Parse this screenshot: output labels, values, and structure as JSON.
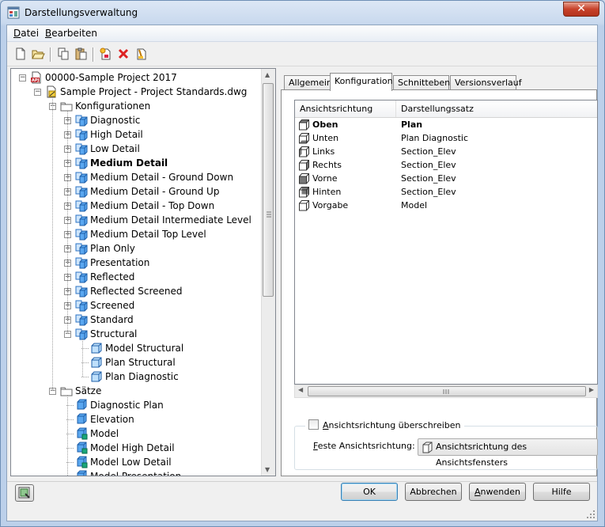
{
  "window": {
    "title": "Darstellungsverwaltung",
    "close_glyph": "✕"
  },
  "menu": [
    {
      "label": "Datei",
      "underline": "D",
      "rest": "atei"
    },
    {
      "label": "Bearbeiten",
      "underline": "B",
      "rest": "earbeiten"
    }
  ],
  "toolbar": [
    "new-icon",
    "open-icon",
    "copy-icon",
    "paste-icon",
    "new-style-icon",
    "delete-icon",
    "purge-icon"
  ],
  "tree": {
    "items": [
      {
        "label": "00000-Sample Project 2017",
        "level": 0,
        "icon": "project-icon",
        "expanded": true
      },
      {
        "label": "Sample Project - Project Standards.dwg",
        "level": 1,
        "icon": "drawing-icon",
        "expanded": true
      },
      {
        "label": "Konfigurationen",
        "level": 2,
        "icon": "folder-icon",
        "expanded": true
      },
      {
        "label": "Diagnostic",
        "level": 3,
        "icon": "config-icon",
        "expandable": true
      },
      {
        "label": "High Detail",
        "level": 3,
        "icon": "config-icon",
        "expandable": true
      },
      {
        "label": "Low Detail",
        "level": 3,
        "icon": "config-icon",
        "expandable": true
      },
      {
        "label": "Medium Detail",
        "level": 3,
        "icon": "config-icon",
        "expandable": true,
        "bold": true
      },
      {
        "label": "Medium Detail - Ground Down",
        "level": 3,
        "icon": "config-icon",
        "expandable": true
      },
      {
        "label": "Medium Detail - Ground Up",
        "level": 3,
        "icon": "config-icon",
        "expandable": true
      },
      {
        "label": "Medium Detail - Top Down",
        "level": 3,
        "icon": "config-icon",
        "expandable": true
      },
      {
        "label": "Medium Detail Intermediate Level",
        "level": 3,
        "icon": "config-icon",
        "expandable": true
      },
      {
        "label": "Medium Detail Top Level",
        "level": 3,
        "icon": "config-icon",
        "expandable": true
      },
      {
        "label": "Plan Only",
        "level": 3,
        "icon": "config-icon",
        "expandable": true
      },
      {
        "label": "Presentation",
        "level": 3,
        "icon": "config-icon",
        "expandable": true
      },
      {
        "label": "Reflected",
        "level": 3,
        "icon": "config-icon",
        "expandable": true
      },
      {
        "label": "Reflected Screened",
        "level": 3,
        "icon": "config-icon",
        "expandable": true
      },
      {
        "label": "Screened",
        "level": 3,
        "icon": "config-icon",
        "expandable": true
      },
      {
        "label": "Standard",
        "level": 3,
        "icon": "config-icon",
        "expandable": true
      },
      {
        "label": "Structural",
        "level": 3,
        "icon": "config-icon",
        "expanded": true
      },
      {
        "label": "Model Structural",
        "level": 4,
        "icon": "cube-icon"
      },
      {
        "label": "Plan Structural",
        "level": 4,
        "icon": "cube-icon"
      },
      {
        "label": "Plan Diagnostic",
        "level": 4,
        "icon": "cube-icon"
      },
      {
        "label": "Sätze",
        "level": 2,
        "icon": "folder-icon",
        "expanded": true
      },
      {
        "label": "Diagnostic Plan",
        "level": 3,
        "icon": "set-icon"
      },
      {
        "label": "Elevation",
        "level": 3,
        "icon": "set-icon"
      },
      {
        "label": "Model",
        "level": 3,
        "icon": "set-model-icon"
      },
      {
        "label": "Model High Detail",
        "level": 3,
        "icon": "set-model-icon"
      },
      {
        "label": "Model Low Detail",
        "level": 3,
        "icon": "set-model-icon"
      },
      {
        "label": "Model Presentation",
        "level": 3,
        "icon": "set-icon"
      }
    ]
  },
  "tabs": [
    {
      "label": "Allgemein",
      "active": false
    },
    {
      "label": "Konfiguration",
      "active": true
    },
    {
      "label": "Schnittebene",
      "active": false
    },
    {
      "label": "Versionsverlauf",
      "active": false
    }
  ],
  "listview": {
    "columns": [
      "Ansichtsrichtung",
      "Darstellungssatz"
    ],
    "rows": [
      {
        "direction": "Oben",
        "set": "Plan",
        "bold": true,
        "face": "top"
      },
      {
        "direction": "Unten",
        "set": "Plan Diagnostic",
        "face": "bottom"
      },
      {
        "direction": "Links",
        "set": "Section_Elev",
        "face": "left"
      },
      {
        "direction": "Rechts",
        "set": "Section_Elev",
        "face": "right"
      },
      {
        "direction": "Vorne",
        "set": "Section_Elev",
        "face": "front"
      },
      {
        "direction": "Hinten",
        "set": "Section_Elev",
        "face": "back"
      },
      {
        "direction": "Vorgabe",
        "set": "Model",
        "face": "none"
      }
    ]
  },
  "override": {
    "checkbox_label": "Ansichtsrichtung überschreiben",
    "checkbox_underline": "A",
    "checkbox_rest": "nsichtsrichtung überschreiben",
    "checked": false,
    "fixed_label": "Feste Ansichtsrichtung:",
    "fixed_underline": "F",
    "fixed_rest": "este Ansichtsrichtung:",
    "combo_value": "Ansichtsrichtung des Ansichtsfensters"
  },
  "buttons": {
    "ok": "OK",
    "cancel": "Abbrechen",
    "apply_underline": "A",
    "apply_rest": "nwenden",
    "apply": "Anwenden",
    "help": "Hilfe"
  },
  "colors": {
    "accent": "#3c7fb1",
    "title_bar": "#c9d9ee",
    "close": "#c7422a"
  }
}
